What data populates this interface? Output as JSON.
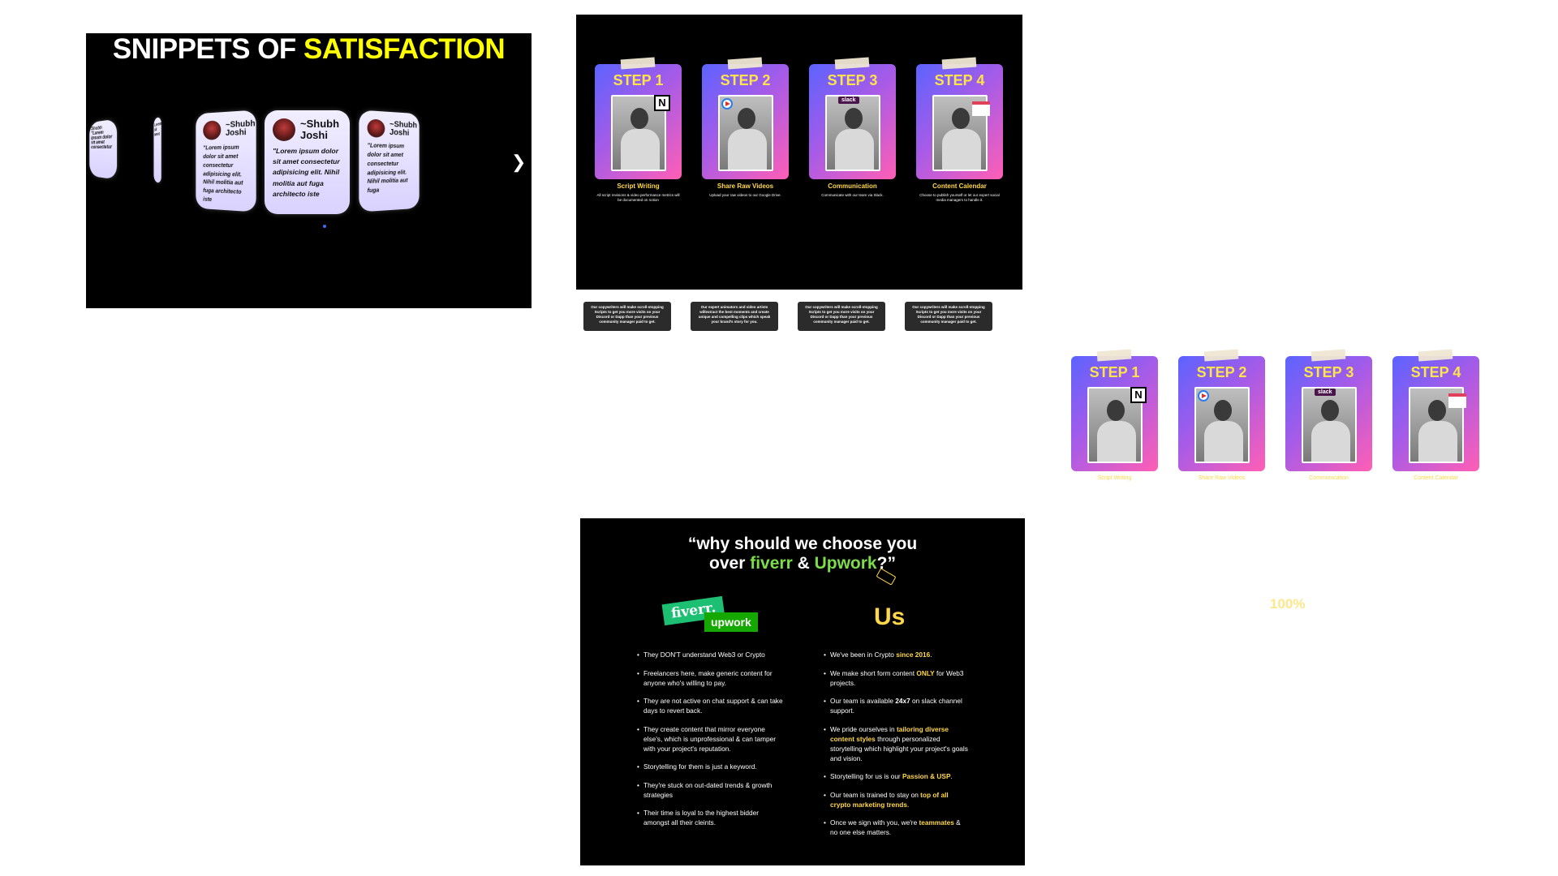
{
  "testimonials": {
    "title_part1": "SNIPPETS OF ",
    "title_part2": "SATISFACTION",
    "cards": [
      {
        "name": "~Shubh Joshi",
        "quote": "\"Lorem ipsum dolor sit amet consectetur adipisicing elit. Nihil molitia aut fuga architecto iste"
      },
      {
        "name": "~Shubh Joshi",
        "quote": "\"Lorem ipsum dolor sit amet consectetur adipisicing elit. Nihil molitia aut fuga architecto iste"
      },
      {
        "name": "~Shubh Joshi",
        "quote": "\"Lorem ipsum dolor sit amet consectetur adipisicing elit. Nihil molitia aut fuga"
      }
    ],
    "edge_cards": [
      {
        "text": "Shubh\n\"Lorem ipsum dolor\nsit amet consectetur"
      },
      {
        "text": "Lorem\nsit amet"
      }
    ],
    "next_icon": "chevron-right-icon"
  },
  "steps": [
    {
      "step": "STEP 1",
      "label": "Script Writing",
      "desc": "All script revisions & video performance metrics will be documented on notion",
      "icon": "notion-icon",
      "note": "Our copywriters will make scroll-stopping Scripts to get you more visits on your Discord or Dapp than your previous community manager paid to get."
    },
    {
      "step": "STEP 2",
      "label": "Share Raw Videos",
      "desc": "Upload your raw videos to our Google Drive.",
      "icon": "google-drive-icon",
      "note": "Our expert animators and video artists willextract the best moments and create unique and compelling clips which speak your brand's story for you."
    },
    {
      "step": "STEP 3",
      "label": "Communication",
      "desc": "Communicate with our team via Slack.",
      "icon": "slack-icon",
      "note": "Our copywriters will make scroll-stopping Scripts to get you more visits on your Discord or Dapp than your previous community manager paid to get."
    },
    {
      "step": "STEP 4",
      "label": "Content Calendar",
      "desc": "Choose to publish yourself or let our expert social media managers to handle it.",
      "icon": "calendar-icon",
      "note": "Our copywriters will make scroll-stopping Scripts to get you more visits on your Discord or Dapp than your previous community manager paid to get."
    }
  ],
  "zoom": "100%",
  "compare": {
    "q_line1": "“why should we choose you",
    "q_over": "over ",
    "q_fiverr": "fiverr",
    "q_amp": " & ",
    "q_upwork": "Upwork",
    "q_end": "?”",
    "fiverr_logo": "fiverr.",
    "upwork_logo": "upwork",
    "us": "Us",
    "them": [
      "They DON'T understand Web3 or Crypto",
      "Freelancers here, make generic content for anyone who's willing to pay.",
      "They are not active on chat support & can take days to revert back.",
      "They create content that mirror everyone else's, which is unprofessional & can tamper with your project's reputation.",
      "Storytelling for them is just a keyword.",
      "They're stuck on out-dated trends & growth strategies",
      "Their time is loyal to the highest bidder amongst all their cleints."
    ],
    "us_items": [
      {
        "a": "We've been in Crypto ",
        "b": "since 2016",
        "c": "."
      },
      {
        "a": "We make short form content ",
        "b": "ONLY",
        "c": " for Web3 projects."
      },
      {
        "a": "Our team is available ",
        "b": "24x7",
        "c": " on slack channel support."
      },
      {
        "a": "We pride ourselves in ",
        "b": "tailoring diverse content styles",
        "c": " through personalized storytelling which highlight your project's goals and vision."
      },
      {
        "a": "Storytelling for us is our ",
        "b": "Passion & USP",
        "c": "."
      },
      {
        "a": "Our team is trained to stay on ",
        "b": "top of all crypto marketing trends",
        "c": "."
      },
      {
        "a": "Once we sign with you, we're ",
        "b": "teammates",
        "c": " & no one else matters."
      }
    ]
  }
}
